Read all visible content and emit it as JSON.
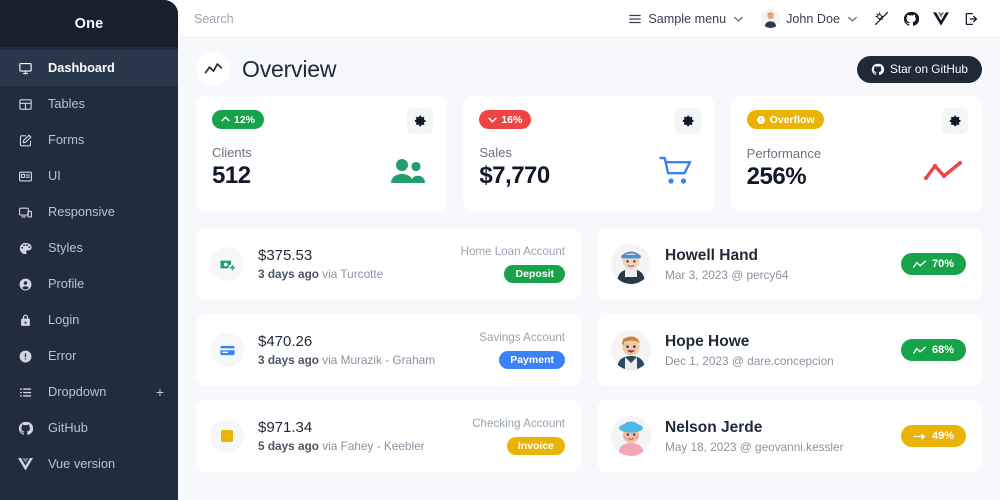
{
  "sidebar": {
    "brand": "One",
    "items": [
      {
        "label": "Dashboard",
        "icon": "monitor-icon",
        "active": true
      },
      {
        "label": "Tables",
        "icon": "table-icon",
        "active": false
      },
      {
        "label": "Forms",
        "icon": "form-edit-icon",
        "active": false
      },
      {
        "label": "UI",
        "icon": "ui-card-icon",
        "active": false
      },
      {
        "label": "Responsive",
        "icon": "responsive-icon",
        "active": false
      },
      {
        "label": "Styles",
        "icon": "palette-icon",
        "active": false
      },
      {
        "label": "Profile",
        "icon": "account-icon",
        "active": false
      },
      {
        "label": "Login",
        "icon": "lock-icon",
        "active": false
      },
      {
        "label": "Error",
        "icon": "alert-circle-icon",
        "active": false
      },
      {
        "label": "Dropdown",
        "icon": "list-icon",
        "active": false,
        "expander": "+"
      },
      {
        "label": "GitHub",
        "icon": "github-icon",
        "active": false
      },
      {
        "label": "Vue version",
        "icon": "vue-icon",
        "active": false
      }
    ]
  },
  "topbar": {
    "search_placeholder": "Search",
    "search_value": "",
    "sample_menu": "Sample menu",
    "user_name": "John Doe",
    "caret": "∨",
    "icons": [
      {
        "name": "theme-toggle-icon"
      },
      {
        "name": "github-icon"
      },
      {
        "name": "vue-icon"
      },
      {
        "name": "logout-icon"
      }
    ]
  },
  "section": {
    "title": "Overview",
    "icon": "chart-timeline-icon",
    "star_button": "Star on GitHub"
  },
  "stat_cards": [
    {
      "badge_text": "12%",
      "badge_color": "#16a34a",
      "badge_icon": "arrow-up-icon",
      "label": "Clients",
      "value": "512",
      "graphic": "people-icon",
      "graphic_color": "#22a06b",
      "gear": "gear-icon"
    },
    {
      "badge_text": "16%",
      "badge_color": "#ef4444",
      "badge_icon": "arrow-down-icon",
      "label": "Sales",
      "value": "$7,770",
      "graphic": "cart-icon",
      "graphic_color": "#3b82f6",
      "gear": "gear-icon"
    },
    {
      "badge_text": "Overflow",
      "badge_color": "#eab308",
      "badge_icon": "alert-circle-icon",
      "label": "Performance",
      "value": "256%",
      "graphic": "trend-line-icon",
      "graphic_color": "#ef4444",
      "gear": "gear-icon"
    }
  ],
  "transactions": [
    {
      "icon": "cash-plus-icon",
      "icon_color": "#22a06b",
      "amount": "$375.53",
      "time": "3 days ago",
      "via": "via Turcotte",
      "account": "Home Loan Account",
      "pill_text": "Deposit",
      "pill_color": "#16a34a"
    },
    {
      "icon": "credit-card-icon",
      "icon_color": "#3b82f6",
      "amount": "$470.26",
      "time": "3 days ago",
      "via": "via Murazik - Graham",
      "account": "Savings Account",
      "pill_text": "Payment",
      "pill_color": "#3b82f6"
    },
    {
      "icon": "receipt-icon",
      "icon_color": "#eab308",
      "amount": "$971.34",
      "time": "5 days ago",
      "via": "via Fahey - Keebler",
      "account": "Checking Account",
      "pill_text": "Invoice",
      "pill_color": "#eab308"
    }
  ],
  "clients": [
    {
      "avatar": "avatar-howell-hand",
      "name": "Howell Hand",
      "meta": "Mar 3, 2023 @ percy64",
      "trend_text": "70%",
      "trend_color": "#16a34a",
      "trend_icon": "trend-up-icon"
    },
    {
      "avatar": "avatar-hope-howe",
      "name": "Hope Howe",
      "meta": "Dec 1, 2023 @ dare.concepcion",
      "trend_text": "68%",
      "trend_color": "#16a34a",
      "trend_icon": "trend-up-icon"
    },
    {
      "avatar": "avatar-nelson-jerde",
      "name": "Nelson Jerde",
      "meta": "May 18, 2023 @ geovanni.kessler",
      "trend_text": "49%",
      "trend_color": "#eab308",
      "trend_icon": "trend-flat-icon"
    }
  ],
  "colors": {
    "sidebar_bg": "#212d3e",
    "sidebar_brand_bg": "#16202e",
    "sidebar_active_bg": "#2a384c",
    "page_bg": "#f7f8fb",
    "card_bg": "#ffffff",
    "dark": "#1f2937"
  }
}
